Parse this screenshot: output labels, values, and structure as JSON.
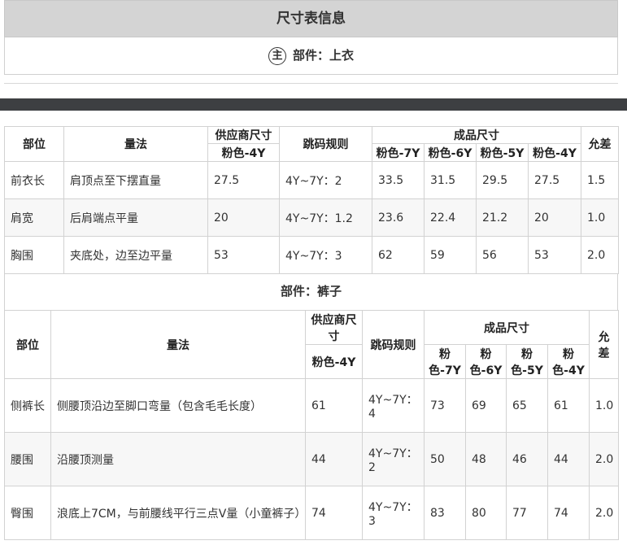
{
  "header": {
    "title": "尺寸表信息"
  },
  "part_top": {
    "icon_char": "主",
    "label": "部件：上衣"
  },
  "part_bottom": {
    "label": "部件：裤子"
  },
  "columns": {
    "part": "部位",
    "method": "量法",
    "supplier": "供应商尺寸",
    "supplier_size": "粉色-4Y",
    "grading": "跳码规则",
    "finished": "成品尺寸",
    "sizes": [
      "粉色-7Y",
      "粉色-6Y",
      "粉色-5Y",
      "粉色-4Y"
    ],
    "tolerance": "允差"
  },
  "top_rows": [
    {
      "part": "前衣长",
      "method": "肩顶点至下摆直量",
      "supplier": "27.5",
      "grading": "4Y~7Y：2",
      "v": [
        "33.5",
        "31.5",
        "29.5",
        "27.5"
      ],
      "tol": "1.5"
    },
    {
      "part": "肩宽",
      "method": "后肩端点平量",
      "supplier": "20",
      "grading": "4Y~7Y：1.2",
      "v": [
        "23.6",
        "22.4",
        "21.2",
        "20"
      ],
      "tol": "1.0"
    },
    {
      "part": "胸围",
      "method": "夹底处，边至边平量",
      "supplier": "53",
      "grading": "4Y~7Y：3",
      "v": [
        "62",
        "59",
        "56",
        "53"
      ],
      "tol": "2.0"
    }
  ],
  "bottom_rows": [
    {
      "part": "侧裤长",
      "method": "侧腰顶沿边至脚口弯量（包含毛毛长度）",
      "supplier": "61",
      "grading": "4Y~7Y：4",
      "v": [
        "73",
        "69",
        "65",
        "61"
      ],
      "tol": "1.0"
    },
    {
      "part": "腰围",
      "method": "沿腰顶测量",
      "supplier": "44",
      "grading": "4Y~7Y：2",
      "v": [
        "50",
        "48",
        "46",
        "44"
      ],
      "tol": "2.0"
    },
    {
      "part": "臀围",
      "method": "浪底上7CM，与前腰线平行三点V量（小童裤子）",
      "supplier": "74",
      "grading": "4Y~7Y：3",
      "v": [
        "83",
        "80",
        "77",
        "74"
      ],
      "tol": "2.0"
    }
  ]
}
